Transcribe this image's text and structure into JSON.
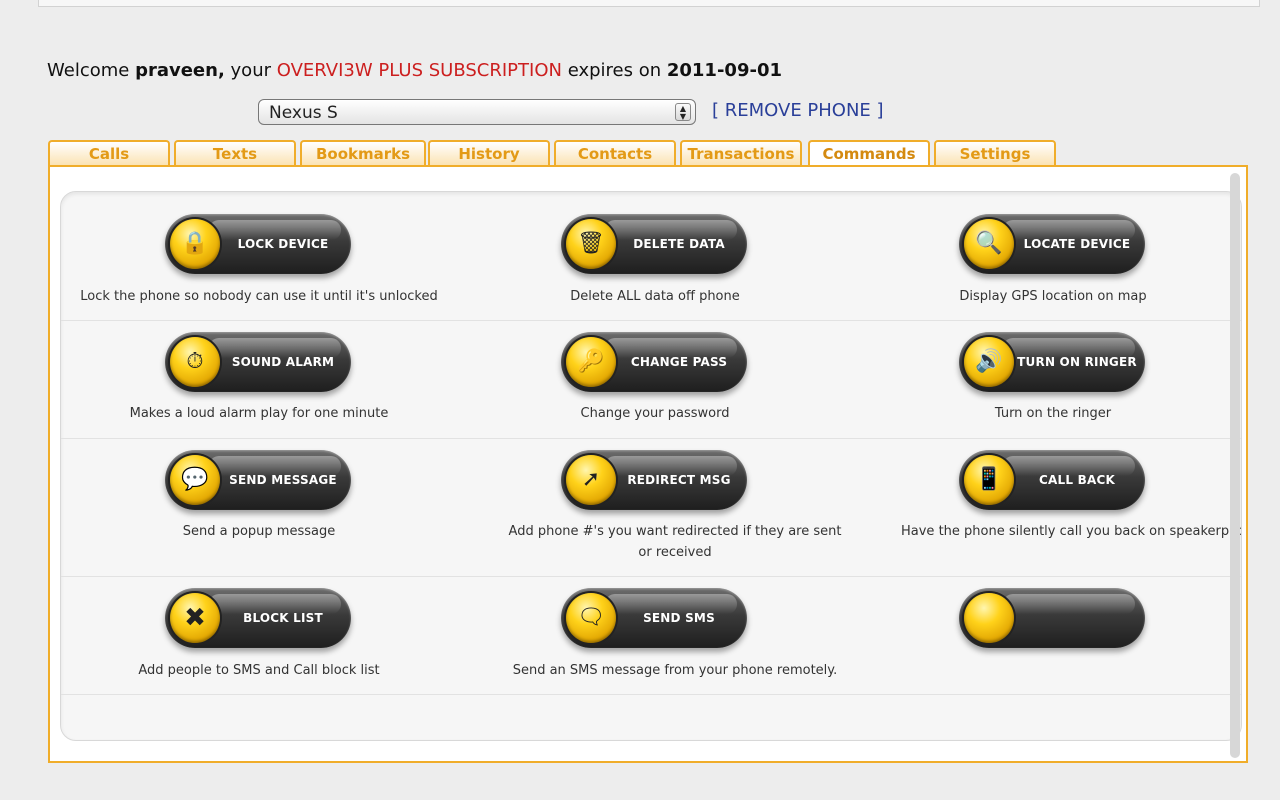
{
  "header": {
    "welcome_prefix": "Welcome",
    "username": "praveen,",
    "your": "your",
    "subscription": "OVERVI3W PLUS SUBSCRIPTION",
    "expires_on": "expires on",
    "expiry_date": "2011-09-01"
  },
  "phone": {
    "selected": "Nexus S",
    "remove_label": "[ REMOVE PHONE ]"
  },
  "tabs": [
    {
      "label": "Calls"
    },
    {
      "label": "Texts"
    },
    {
      "label": "Bookmarks"
    },
    {
      "label": "History"
    },
    {
      "label": "Contacts"
    },
    {
      "label": "Transactions"
    },
    {
      "label": "Commands",
      "active": true
    },
    {
      "label": "Settings"
    }
  ],
  "commands": [
    {
      "label": "LOCK DEVICE",
      "icon": "lock-icon",
      "desc": "Lock the phone so nobody can use it until it's unlocked"
    },
    {
      "label": "DELETE DATA",
      "icon": "trash-icon",
      "desc": "Delete ALL data off phone"
    },
    {
      "label": "LOCATE DEVICE",
      "icon": "magnifier-icon",
      "desc": "Display GPS location on map"
    },
    {
      "label": "SOUND ALARM",
      "icon": "clock-icon",
      "desc": "Makes a loud alarm play for one minute"
    },
    {
      "label": "CHANGE PASS",
      "icon": "key-icon",
      "desc": "Change your password"
    },
    {
      "label": "TURN ON RINGER",
      "icon": "speaker-icon",
      "desc": "Turn on the ringer"
    },
    {
      "label": "SEND MESSAGE",
      "icon": "speech-bubble-icon",
      "desc": "Send a popup message"
    },
    {
      "label": "REDIRECT MSG",
      "icon": "arrow-icon",
      "desc": "Add phone #'s you want redirected if they are sent or received"
    },
    {
      "label": "CALL BACK",
      "icon": "phone-icon",
      "desc": "Have the phone silently call you back on speakerphone"
    },
    {
      "label": "BLOCK LIST",
      "icon": "x-icon",
      "desc": "Add people to SMS and Call block list"
    },
    {
      "label": "SEND SMS",
      "icon": "sms-bubble-icon",
      "desc": "Send an SMS message from your phone remotely."
    },
    {
      "label": "",
      "icon": "blank-icon",
      "desc": ""
    }
  ]
}
